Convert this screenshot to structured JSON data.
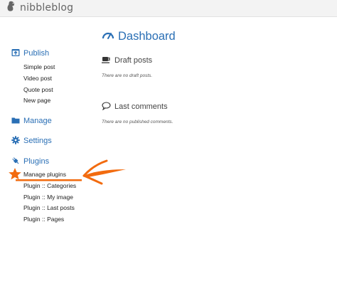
{
  "brand": {
    "name": "nibbleblog"
  },
  "colors": {
    "accent": "#2a6fb5",
    "annotation": "#f26b0f"
  },
  "sidebar": {
    "sections": [
      {
        "label": "Publish",
        "icon": "publish-icon",
        "items": [
          {
            "label": "Simple post"
          },
          {
            "label": "Video post"
          },
          {
            "label": "Quote post"
          },
          {
            "label": "New page"
          }
        ]
      },
      {
        "label": "Manage",
        "icon": "folder-icon",
        "items": []
      },
      {
        "label": "Settings",
        "icon": "gear-icon",
        "items": []
      },
      {
        "label": "Plugins",
        "icon": "plug-icon",
        "items": [
          {
            "label": "Manage plugins"
          },
          {
            "label": "Plugin :: Categories"
          },
          {
            "label": "Plugin :: My image"
          },
          {
            "label": "Plugin :: Last posts"
          },
          {
            "label": "Plugin :: Pages"
          }
        ]
      }
    ]
  },
  "main": {
    "title": "Dashboard",
    "title_icon": "dashboard-gauge-icon",
    "panels": [
      {
        "title": "Draft posts",
        "icon": "coffee-cup-icon",
        "empty_text": "There are no draft posts."
      },
      {
        "title": "Last comments",
        "icon": "comment-bubble-icon",
        "empty_text": "There are no published comments."
      }
    ]
  },
  "annotation": {
    "highlighted_item": "Manage plugins",
    "marks": [
      "star-icon",
      "arrow-icon",
      "underline"
    ]
  }
}
